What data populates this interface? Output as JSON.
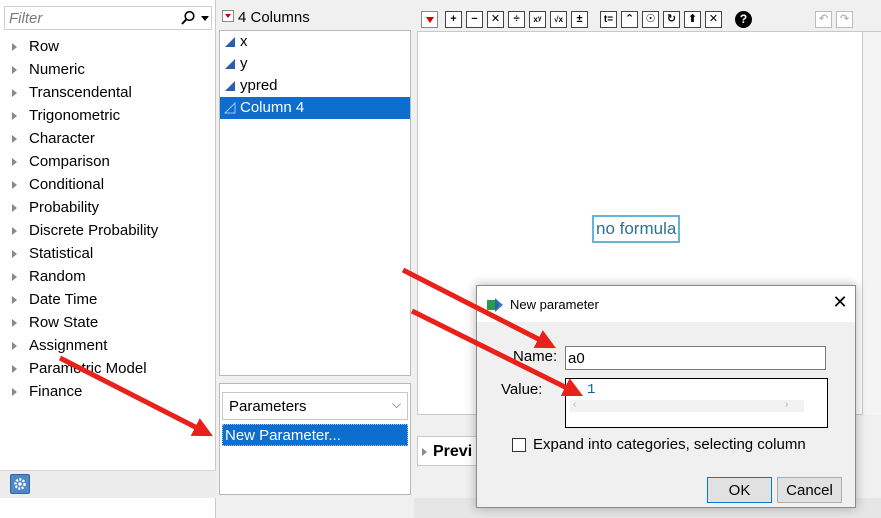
{
  "left_panel": {
    "filter_placeholder": "Filter",
    "categories": [
      "Row",
      "Numeric",
      "Transcendental",
      "Trigonometric",
      "Character",
      "Comparison",
      "Conditional",
      "Probability",
      "Discrete Probability",
      "Statistical",
      "Random",
      "Date Time",
      "Row State",
      "Assignment",
      "Parametric Model",
      "Finance"
    ]
  },
  "columns_panel": {
    "header": "4 Columns",
    "columns": [
      "x",
      "y",
      "ypred",
      "Column 4"
    ],
    "selected_index": 3
  },
  "parameters_panel": {
    "dropdown_label": "Parameters",
    "items": [
      "New Parameter..."
    ]
  },
  "formula_editor": {
    "placeholder": "no formula",
    "preview_label": "Previ"
  },
  "dialog": {
    "title": "New parameter",
    "close": "✕",
    "name_label": "Name:",
    "name_value": "a0",
    "value_label": "Value:",
    "value_text": "1",
    "checkbox_label": "Expand into categories, selecting column",
    "ok_label": "OK",
    "cancel_label": "Cancel"
  },
  "colors": {
    "selection": "#0d6ecd",
    "arrow": "#e8211b",
    "formula_border": "#62b5d6"
  }
}
